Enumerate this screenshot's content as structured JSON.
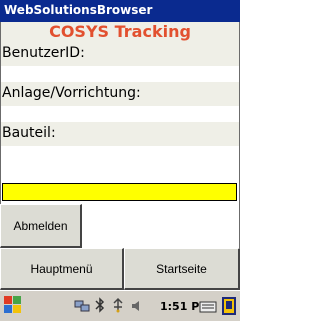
{
  "window": {
    "title": "WebSolutionsBrowser"
  },
  "app": {
    "heading": "COSYS Tracking"
  },
  "fields": [
    {
      "label": "BenutzerID:"
    },
    {
      "label": "Anlage/Vorrichtung:"
    },
    {
      "label": "Bauteil:"
    }
  ],
  "scan_field": {
    "value": "",
    "color": "#ffff00"
  },
  "buttons": {
    "logout": "Abmelden",
    "main_menu": "Hauptmenü",
    "home": "Startseite"
  },
  "taskbar": {
    "time": "1:51 PM",
    "icons": [
      "start-menu-icon",
      "network-icon",
      "bluetooth-icon",
      "usb-icon",
      "volume-icon",
      "keyboard-icon",
      "desktop-icon"
    ]
  },
  "colors": {
    "titlebar": "#0a2a8f",
    "heading": "#e2502f",
    "scan_field": "#ffff00"
  }
}
